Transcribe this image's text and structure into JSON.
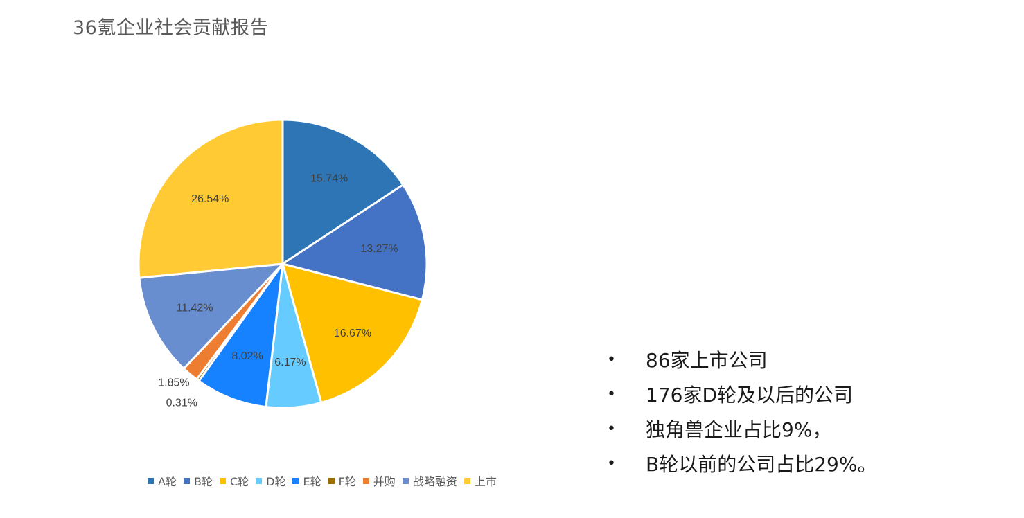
{
  "title": "36氪企业社会贡献报告",
  "chart_data": {
    "type": "pie",
    "title": "",
    "start_angle_deg": 0,
    "direction": "clockwise",
    "categories": [
      "A轮",
      "B轮",
      "C轮",
      "D轮",
      "E轮",
      "F轮",
      "并购",
      "战略融资",
      "上市"
    ],
    "values": [
      15.74,
      13.27,
      16.67,
      6.17,
      8.02,
      0.31,
      1.85,
      11.42,
      26.54
    ],
    "labels": [
      "15.74%",
      "13.27%",
      "16.67%",
      "6.17%",
      "8.02%",
      "0.31%",
      "1.85%",
      "11.42%",
      "26.54%"
    ],
    "colors": [
      "#2E75B6",
      "#4472C4",
      "#FFC000",
      "#66CCFF",
      "#1682FF",
      "#9C6F00",
      "#ED7D31",
      "#698ED0",
      "#FFCA33"
    ],
    "legend_position": "bottom",
    "unit": "%"
  },
  "bullets": [
    "86家上市公司",
    "176家D轮及以后的公司",
    "独角兽企业占比9%，",
    "B轮以前的公司占比29%。"
  ],
  "bullet_symbol": "•"
}
